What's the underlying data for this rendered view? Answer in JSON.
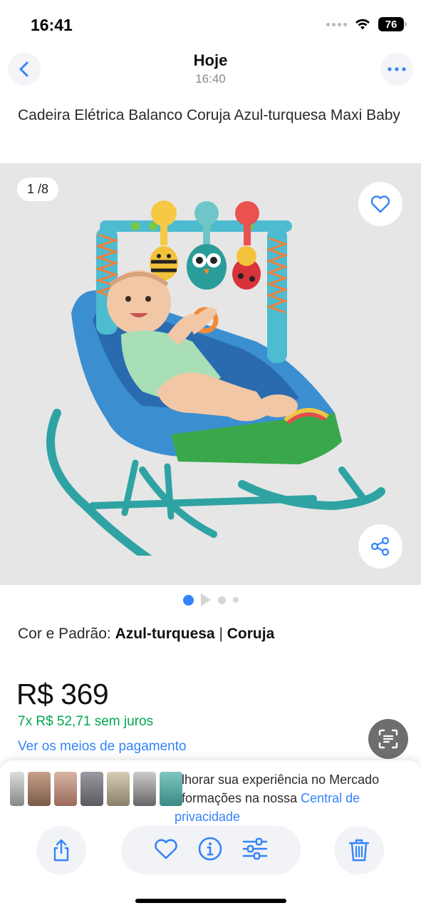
{
  "status_bar": {
    "time": "16:41",
    "battery": "76"
  },
  "header": {
    "title": "Hoje",
    "subtitle": "16:40"
  },
  "product": {
    "title": "Cadeira Elétrica Balanco Coruja Azul-turquesa Maxi Baby",
    "image_counter": "1 /8",
    "variant_label": "Cor e Padrão:",
    "variant_color": "Azul-turquesa",
    "variant_separator": "|",
    "variant_pattern": "Coruja",
    "price": "R$ 369",
    "installments": "7x R$ 52,71 sem juros",
    "payment_link": "Ver os meios de pagamento"
  },
  "privacy_notice": {
    "line1": "elhorar sua experiência no Mercado",
    "line2": "nformações na nossa",
    "link": "Central de privacidade"
  },
  "icons": {
    "back": "chevron-left-icon",
    "more": "ellipsis-icon",
    "favorite": "heart-icon",
    "share": "share-icon",
    "scan": "text-scan-icon",
    "export": "share-upload-icon",
    "info": "info-icon",
    "adjust": "sliders-icon",
    "delete": "trash-icon"
  },
  "colors": {
    "accent": "#3483fa",
    "green": "#00a650",
    "gallery_bg": "#e6e6e6"
  }
}
